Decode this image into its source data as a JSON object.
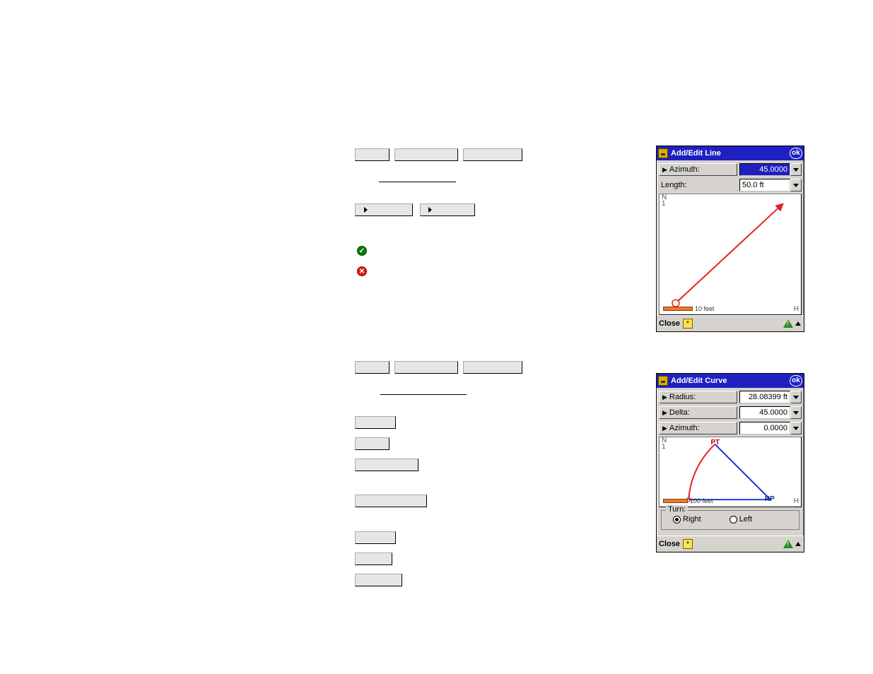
{
  "left": {
    "row1_chips": [
      "",
      "",
      ""
    ],
    "row2_chips": [
      "",
      ""
    ],
    "status_ok": "",
    "status_err": ""
  },
  "dialog_line": {
    "title": "Add/Edit Line",
    "ok": "ok",
    "azimuth_label": "Azimuth:",
    "azimuth_value": "45.0000",
    "length_label": "Length:",
    "length_value": "50.0 ft",
    "preview": {
      "n": "N\n1",
      "h": "H",
      "scale_label": "10 feet"
    },
    "close": "Close"
  },
  "dialog_curve": {
    "title": "Add/Edit Curve",
    "ok": "ok",
    "radius_label": "Radius:",
    "radius_value": "28.08399 ft",
    "delta_label": "Delta:",
    "delta_value": "45.0000",
    "azimuth_label": "Azimuth:",
    "azimuth_value": "0.0000",
    "preview": {
      "n": "N\n1",
      "h": "H",
      "scale_label": "100 feet",
      "pt": "PT",
      "rp": "RP"
    },
    "turn_legend": "Turn:",
    "turn_right": "Right",
    "turn_left": "Left",
    "turn_value": "Right",
    "close": "Close"
  }
}
